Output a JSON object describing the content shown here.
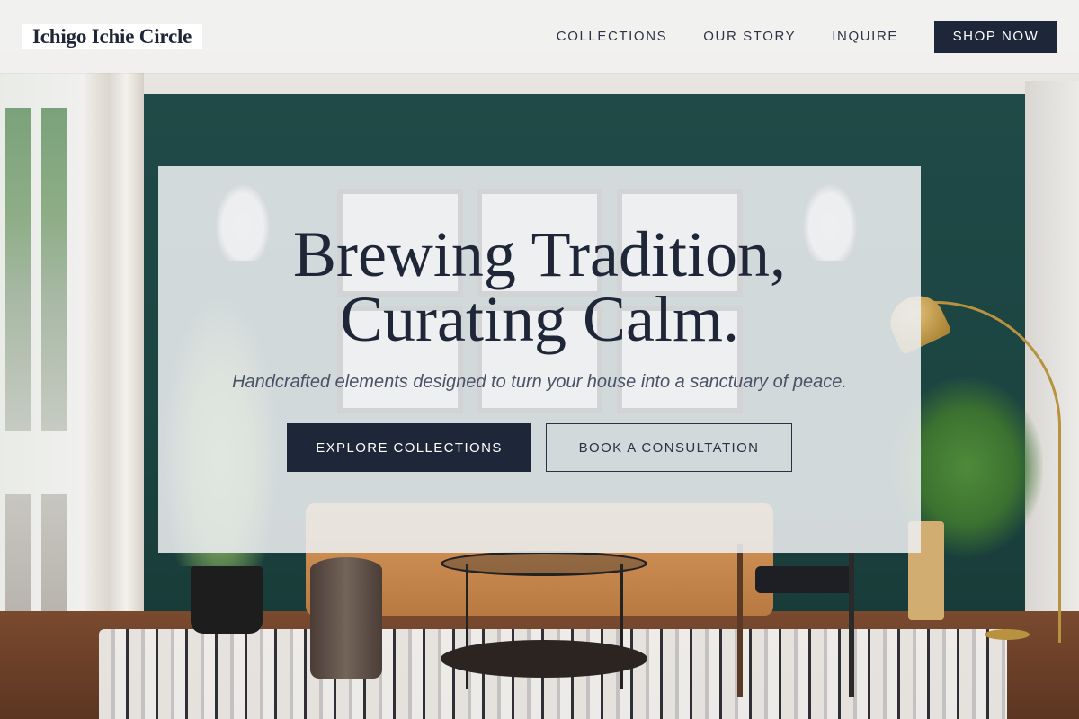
{
  "header": {
    "logo": "Ichigo Ichie Circle",
    "nav": [
      {
        "label": "COLLECTIONS"
      },
      {
        "label": "OUR STORY"
      },
      {
        "label": "INQUIRE"
      }
    ],
    "cta_label": "SHOP NOW"
  },
  "hero": {
    "title_line1": "Brewing Tradition,",
    "title_line2": "Curating Calm.",
    "subtitle": "Handcrafted elements designed to turn your house into a sanctuary of peace.",
    "primary_cta": "EXPLORE COLLECTIONS",
    "secondary_cta": "BOOK A CONSULTATION"
  },
  "colors": {
    "navy": "#1e273a",
    "wall_green": "#1f4a47",
    "header_bg": "#f0f0ef"
  }
}
